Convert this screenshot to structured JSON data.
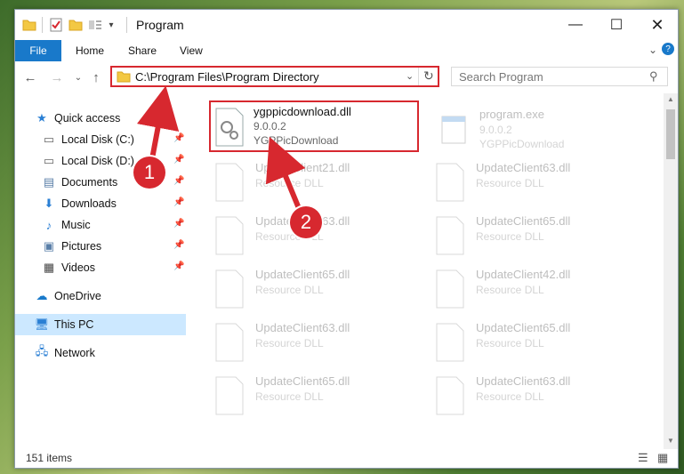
{
  "window": {
    "title": "Program"
  },
  "ribbon": {
    "file": "File",
    "tabs": [
      "Home",
      "Share",
      "View"
    ]
  },
  "address": {
    "path": "C:\\Program Files\\Program Directory"
  },
  "search": {
    "placeholder": "Search Program"
  },
  "nav": {
    "items": [
      {
        "label": "Quick access",
        "icon": "star-icon"
      },
      {
        "label": "Local Disk (C:)",
        "icon": "drive-icon"
      },
      {
        "label": "Local Disk (D:)",
        "icon": "drive-icon"
      },
      {
        "label": "Documents",
        "icon": "documents-icon"
      },
      {
        "label": "Downloads",
        "icon": "download-icon"
      },
      {
        "label": "Music",
        "icon": "music-icon"
      },
      {
        "label": "Pictures",
        "icon": "pictures-icon"
      },
      {
        "label": "Videos",
        "icon": "videos-icon"
      },
      {
        "label": "OneDrive",
        "icon": "cloud-icon"
      },
      {
        "label": "This PC",
        "icon": "computer-icon"
      },
      {
        "label": "Network",
        "icon": "network-icon"
      }
    ]
  },
  "files": [
    {
      "name": "ygppicdownload.dll",
      "version": "9.0.0.2",
      "desc": "YGPPicDownload"
    },
    {
      "name": "program.exe",
      "version": "9.0.0.2",
      "desc": "YGPPicDownload"
    },
    {
      "name": "UpdateClient21.dll",
      "desc": "Resource DLL"
    },
    {
      "name": "UpdateClient63.dll",
      "desc": "Resource DLL"
    },
    {
      "name": "UpdateClient63.dll",
      "desc": "Resource DLL"
    },
    {
      "name": "UpdateClient65.dll",
      "desc": "Resource DLL"
    },
    {
      "name": "UpdateClient65.dll",
      "desc": "Resource DLL"
    },
    {
      "name": "UpdateClient42.dll",
      "desc": "Resource DLL"
    },
    {
      "name": "UpdateClient63.dll",
      "desc": "Resource DLL"
    },
    {
      "name": "UpdateClient65.dll",
      "desc": "Resource DLL"
    },
    {
      "name": "UpdateClient65.dll",
      "desc": "Resource DLL"
    },
    {
      "name": "UpdateClient63.dll",
      "desc": "Resource DLL"
    }
  ],
  "status": {
    "count": "151 items"
  },
  "callouts": [
    "1",
    "2"
  ],
  "colors": {
    "accent": "#1979ca",
    "highlight": "#d7282f",
    "selected": "#cce8ff"
  }
}
